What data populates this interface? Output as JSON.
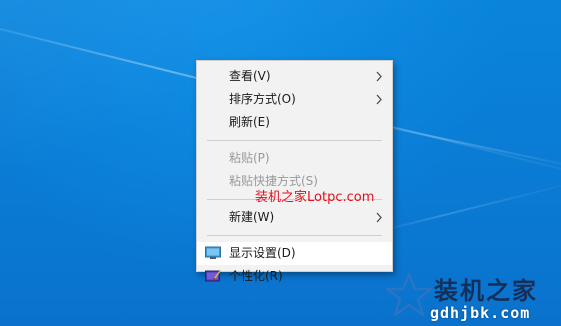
{
  "context_menu": {
    "items": [
      {
        "label": "查看(V)",
        "has_submenu": true,
        "enabled": true
      },
      {
        "label": "排序方式(O)",
        "has_submenu": true,
        "enabled": true
      },
      {
        "label": "刷新(E)",
        "has_submenu": false,
        "enabled": true
      },
      {
        "label": "粘贴(P)",
        "has_submenu": false,
        "enabled": false
      },
      {
        "label": "粘贴快捷方式(S)",
        "has_submenu": false,
        "enabled": false
      },
      {
        "label": "新建(W)",
        "has_submenu": true,
        "enabled": true
      },
      {
        "label": "显示设置(D)",
        "has_submenu": false,
        "enabled": true,
        "icon": "display-settings-icon",
        "highlighted": true
      },
      {
        "label": "个性化(R)",
        "has_submenu": false,
        "enabled": true,
        "icon": "personalize-icon"
      }
    ]
  },
  "watermark": {
    "overlay_text": "装机之家Lotpc.com",
    "corner_title": "装机之家",
    "corner_url": "gdhjbk.com"
  },
  "colors": {
    "desktop_blue": "#0a7fd6",
    "menu_background": "#f2f2f2",
    "watermark_red": "#e3101a"
  }
}
